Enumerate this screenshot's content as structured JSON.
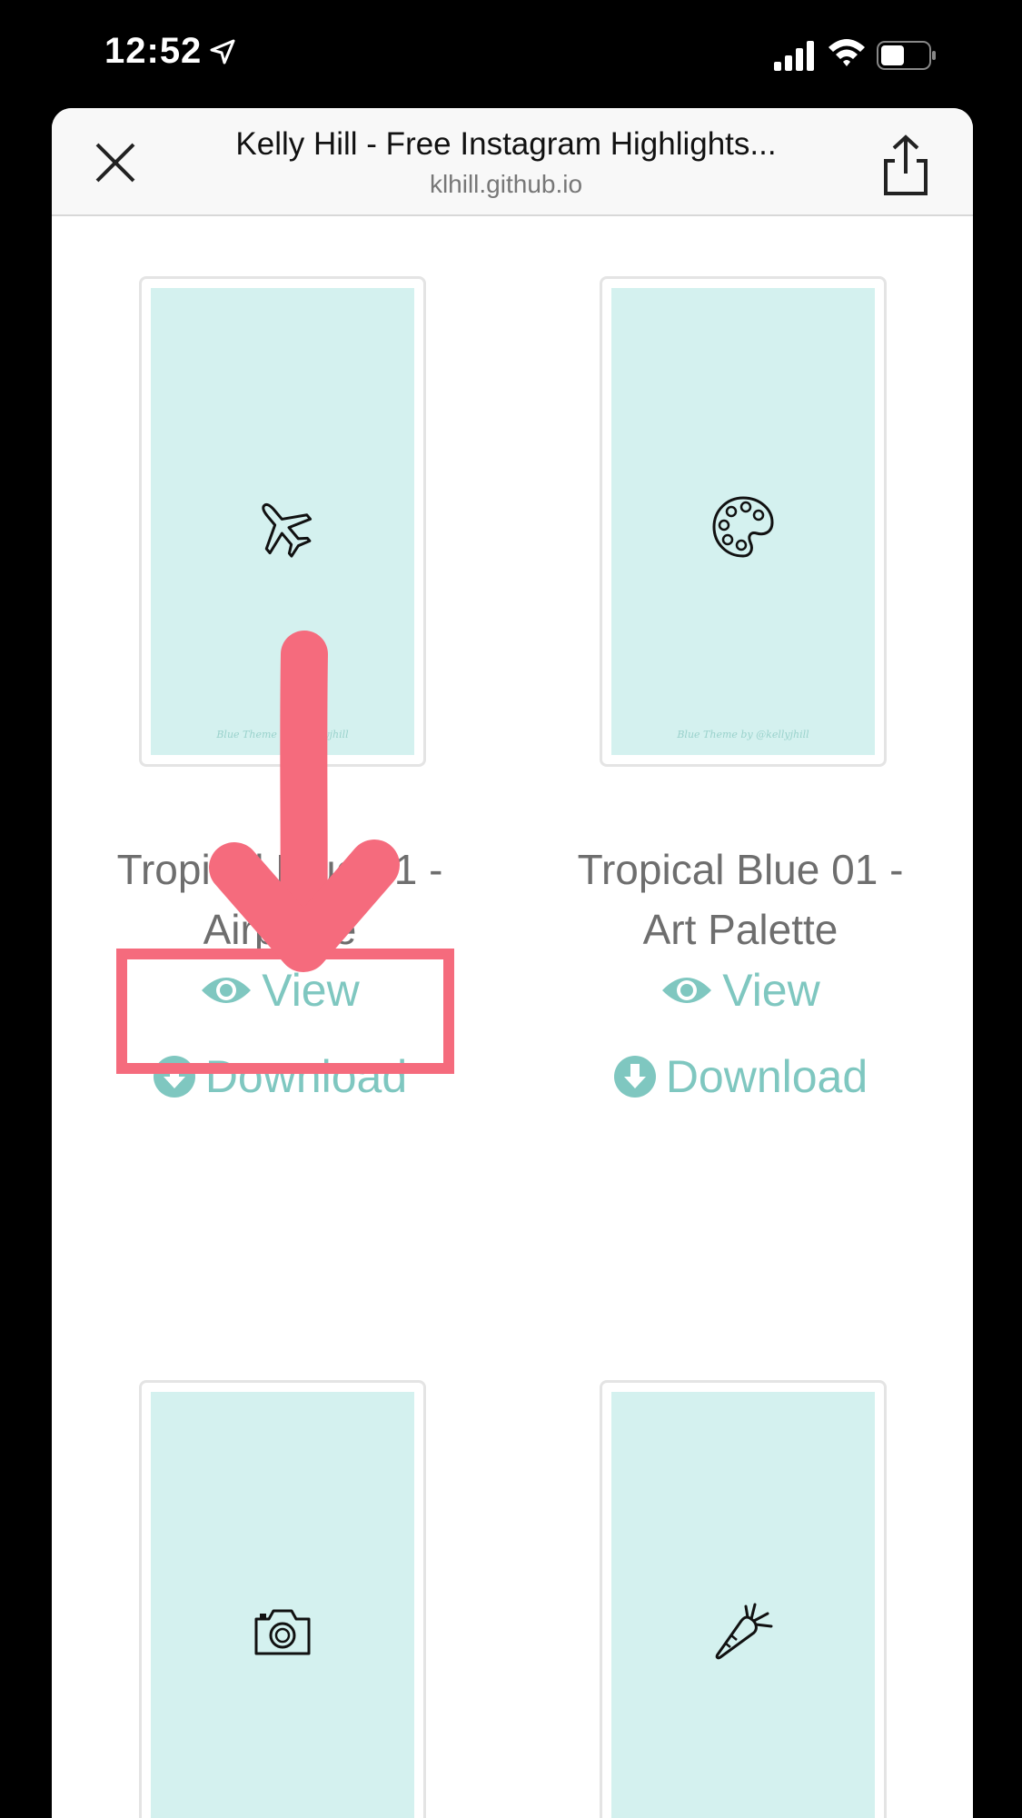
{
  "status": {
    "time": "12:52"
  },
  "browser": {
    "title": "Kelly Hill - Free Instagram Highlights...",
    "url": "klhill.github.io"
  },
  "cards": [
    {
      "title_line1": "Tropical Blue 01 -",
      "title_line2": "Airplane",
      "watermark": "Blue Theme by @kellyjhill",
      "icon": "airplane-icon"
    },
    {
      "title_line1": "Tropical Blue 01 -",
      "title_line2": "Art Palette",
      "watermark": "Blue Theme by @kellyjhill",
      "icon": "palette-icon"
    },
    {
      "watermark": "",
      "icon": "camera-icon"
    },
    {
      "watermark": "",
      "icon": "carrot-icon"
    }
  ],
  "actions": {
    "view_label": "View",
    "download_label": "Download"
  },
  "colors": {
    "accent": "#7fc7c0",
    "card_bg": "#d4f1ef",
    "annotation": "#f56b7d"
  }
}
